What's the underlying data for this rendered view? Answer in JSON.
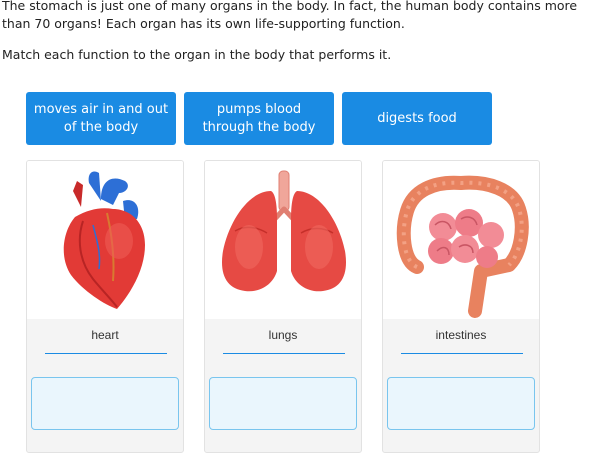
{
  "intro": "The stomach is just one of many organs in the body. In fact, the human body contains more than 70 organs! Each organ has its own life-supporting function.",
  "prompt": "Match each function to the organ in the body that performs it.",
  "choices": [
    {
      "label": "moves air in and out of the body"
    },
    {
      "label": "pumps blood through the body"
    },
    {
      "label": "digests food"
    }
  ],
  "organs": [
    {
      "label": "heart",
      "icon": "heart-image"
    },
    {
      "label": "lungs",
      "icon": "lungs-image"
    },
    {
      "label": "intestines",
      "icon": "intestines-image"
    }
  ],
  "colors": {
    "choice_bg": "#1a8be3",
    "drop_bg": "#eaf6fd",
    "drop_border": "#79c5ee",
    "organ_red": "#e23a36"
  }
}
